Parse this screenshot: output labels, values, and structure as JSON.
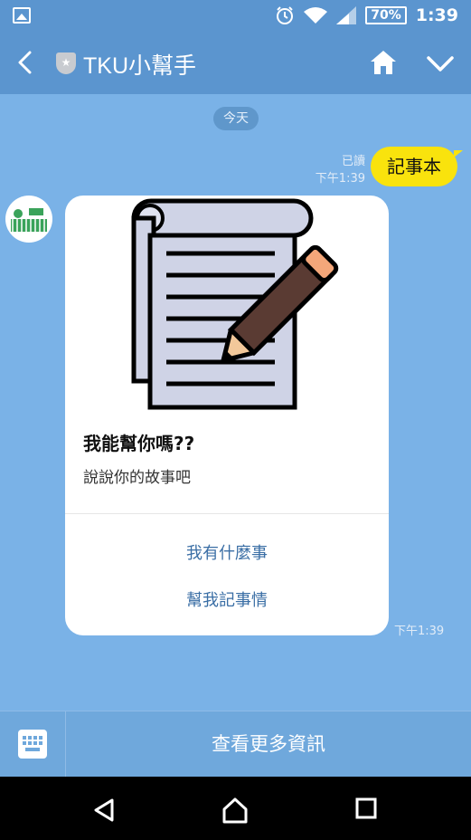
{
  "status": {
    "battery": "70%",
    "time": "1:39"
  },
  "header": {
    "title": "TKU小幫手"
  },
  "chat": {
    "date": "今天",
    "my_message": {
      "text": "記事本",
      "read": "已讀",
      "time": "下午1:39"
    },
    "bot_card": {
      "title": "我能幫你嗎??",
      "subtitle": "說說你的故事吧",
      "buttons": [
        "我有什麼事",
        "幫我記事情"
      ],
      "time": "下午1:39"
    }
  },
  "bottom": {
    "more_label": "查看更多資訊"
  },
  "colors": {
    "header": "#5b95cf",
    "chat_bg": "#7ab2e7",
    "my_bubble": "#f9e30d",
    "link": "#3a6ea5"
  },
  "icons": [
    "image-icon",
    "alarm-icon",
    "wifi-icon",
    "signal-icon",
    "battery-icon",
    "back-icon",
    "shield-icon",
    "home-icon",
    "chevron-down-icon",
    "notebook-pencil-icon",
    "keyboard-icon",
    "nav-back-icon",
    "nav-home-icon",
    "nav-recents-icon"
  ]
}
